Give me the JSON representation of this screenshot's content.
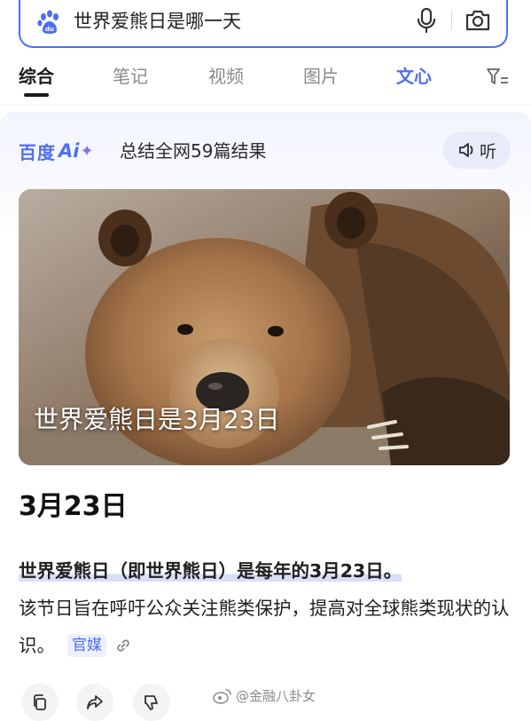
{
  "search": {
    "query": "世界爱熊日是哪一天"
  },
  "tabs": [
    {
      "label": "综合",
      "active": true
    },
    {
      "label": "笔记",
      "active": false
    },
    {
      "label": "视频",
      "active": false
    },
    {
      "label": "图片",
      "active": false
    },
    {
      "label": "文心",
      "active": false
    }
  ],
  "ai_card": {
    "logo_text": "百度",
    "logo_ai": "Ai",
    "logo_sparkle": "✦",
    "summary": "总结全网59篇结果",
    "listen_label": "听",
    "image_caption": "世界爱熊日是3月23日",
    "answer_title": "3月23日",
    "paragraph_highlight": "世界爱熊日（即世界熊日）是每年的3月23日。",
    "paragraph_body": "该节日旨在呼吁公众关注熊类保护，提高对全球熊类现状的认识。",
    "source_tag": "官媒"
  },
  "watermark": "@金融八卦女",
  "colors": {
    "accent": "#4e6ef2",
    "ai_purple": "#8b6cf6",
    "tag_bg": "#eef0fd"
  },
  "icons": [
    "baidu-paw-icon",
    "microphone-icon",
    "camera-icon",
    "filter-icon",
    "speaker-icon",
    "link-icon",
    "copy-icon",
    "share-icon",
    "dislike-icon",
    "weibo-icon"
  ]
}
